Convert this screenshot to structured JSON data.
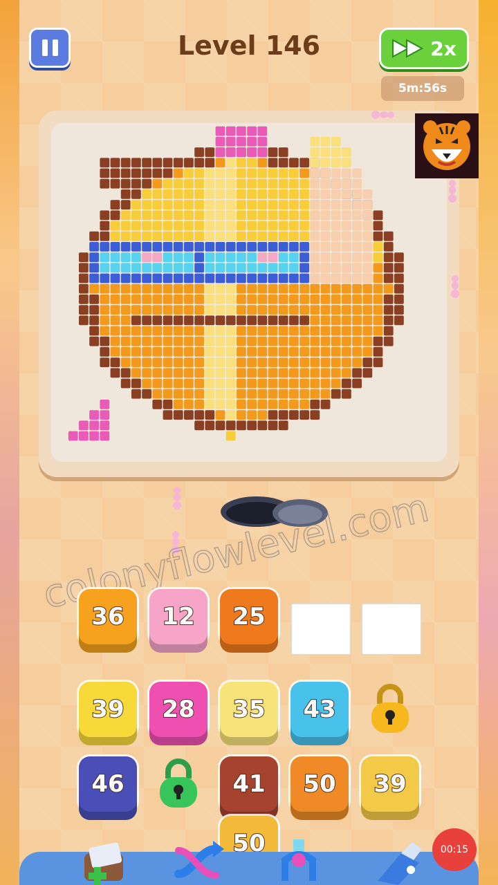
{
  "header": {
    "level_title": "Level 146",
    "speed_label": "2x",
    "timer": "5m:56s"
  },
  "watermark": "colonyflowlevel.com",
  "slots": [
    {
      "value": "36",
      "color": "#f6a21e"
    },
    {
      "value": "12",
      "color": "#f6a5c9"
    },
    {
      "value": "25",
      "color": "#ef7a1e"
    },
    {
      "value": "",
      "color": "#ffffff"
    },
    {
      "value": "",
      "color": "#ffffff"
    }
  ],
  "queue_row1": [
    {
      "value": "39",
      "color": "#f8d93a"
    },
    {
      "value": "28",
      "color": "#ef4fb0"
    },
    {
      "value": "35",
      "color": "#f8e27a"
    },
    {
      "value": "43",
      "color": "#48c2ea"
    },
    {
      "lock": "gold-lock-icon",
      "color": "#f6b81c"
    }
  ],
  "queue_row2": [
    {
      "value": "46",
      "color": "#4a4fb8"
    },
    {
      "lock": "green-lock-icon",
      "color": "#37c45a"
    },
    {
      "value": "41",
      "color": "#a5432f"
    },
    {
      "value": "50",
      "color": "#ef8a26"
    },
    {
      "value": "39",
      "color": "#f3c948"
    }
  ],
  "queue_row3": [
    {
      "value": "50",
      "color": "#f3b938"
    }
  ],
  "tools": [
    "add-box-icon",
    "shuffle-icon",
    "claw-icon",
    "vacuum-icon"
  ],
  "record_timer": "00:15",
  "palette": {
    "brown": "#8a3e22",
    "orange": "#f39a1c",
    "yellow": "#f7cd3a",
    "light_yellow": "#f9e07c",
    "peach": "#f8cfae",
    "blue": "#3b5dd6",
    "cyan": "#57d2ef",
    "pink": "#f3a8c6",
    "magenta": "#e95bb6"
  }
}
